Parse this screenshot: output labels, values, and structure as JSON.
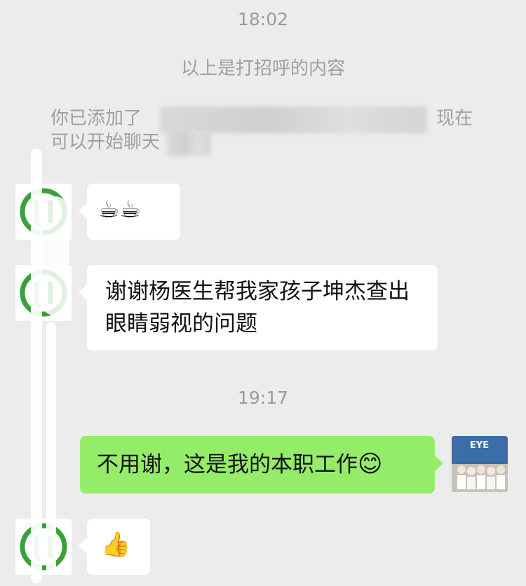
{
  "messages": {
    "time_1": "18:02",
    "greeting_note": "以上是打招呼的内容",
    "added_note_prefix": "你已添加了",
    "added_note_suffix": "现在",
    "added_note_line2": "可以开始聊天",
    "coffee_emojis": "☕☕",
    "thanks_text": "谢谢杨医生帮我家孩子坤杰查出眼睛弱视的问题",
    "time_2": "19:17",
    "reply_text": "不用谢，这是我的本职工作",
    "reply_emoji": "😊",
    "thumbs_emoji": "👍",
    "photo_badge_text": "EYE"
  },
  "colors": {
    "background": "#ececec",
    "bubble_in": "#ffffff",
    "bubble_out": "#95ec69",
    "avatar_logo": "#3aa13a"
  },
  "icons": [
    "contact-logo-icon",
    "photo-avatar"
  ]
}
